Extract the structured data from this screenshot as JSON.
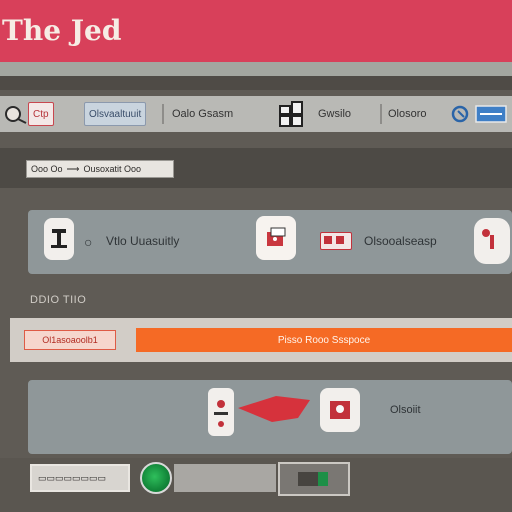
{
  "window": {
    "title": "The Jed"
  },
  "toolbar": {
    "tab_1": "Ctp",
    "tab_2": "Olsvaaltuuit",
    "item_1": "Oalo Gsasm",
    "item_2": "Gwsilo",
    "item_3": "Olosoro"
  },
  "breadcrumb": {
    "part_1": "Ooo Oo",
    "part_2": "Ousoxatit Ooo"
  },
  "card1": {
    "label": "Vtlo Uuasuitly",
    "status": "Olsooalseasp"
  },
  "section": {
    "label": "DDIO TIIO"
  },
  "actions": {
    "secondary": "Ol1asoaoolb1",
    "primary": "Pisso Rooo Ssspoce"
  },
  "card2": {
    "status": "Olsoiit"
  },
  "colors": {
    "accent": "#d8405a",
    "primary_button": "#f56a25",
    "toggle": "#13873a"
  },
  "icons": [
    "search-icon",
    "copy-icon",
    "grid-icon",
    "edit-icon",
    "sync-icon",
    "lock-icon",
    "gift-icon",
    "user-icon",
    "stack-icon",
    "alert-icon",
    "image-icon"
  ]
}
